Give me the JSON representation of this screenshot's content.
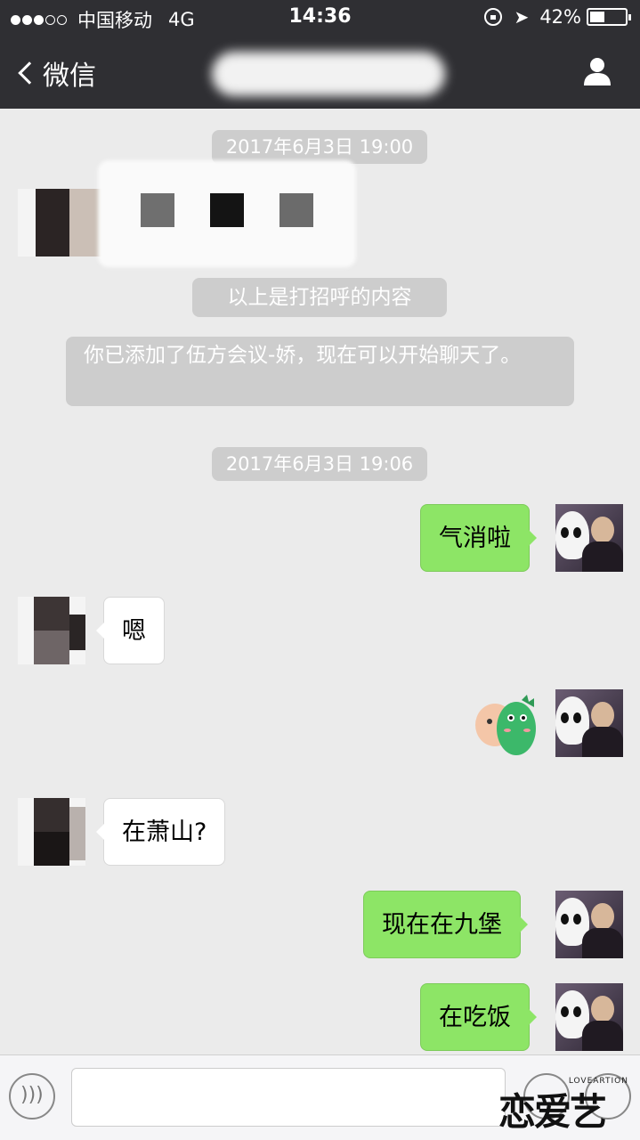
{
  "status_bar": {
    "carrier": "中国移动",
    "network": "4G",
    "time": "14:36",
    "battery": "42%",
    "battery_level": 0.42,
    "signal_dots_filled": 3,
    "signal_dots_total": 5
  },
  "nav": {
    "back_label": "微信",
    "icon": "person-icon"
  },
  "chat": {
    "timestamps": [
      "2017年6月3日 19:00",
      "2017年6月3日 19:06"
    ],
    "system_greeting": "以上是打招呼的内容",
    "system_added": "你已添加了伍方会议-娇，现在可以开始聊天了。",
    "messages": [
      {
        "side": "right",
        "text": "气消啦"
      },
      {
        "side": "left",
        "text": "嗯"
      },
      {
        "side": "right",
        "type": "sticker",
        "text": ""
      },
      {
        "side": "left",
        "text": "在萧山?"
      },
      {
        "side": "right",
        "text": "现在在九堡"
      },
      {
        "side": "right",
        "text": "在吃饭"
      }
    ]
  },
  "input_bar": {
    "watermark_main": "恋爱艺术",
    "watermark_sub": "LOVEARTION"
  },
  "colors": {
    "topbar": "#2f2f33",
    "chat_bg": "#ebebeb",
    "bubble_me": "#8de566",
    "bubble_other": "#ffffff",
    "system_pill": "#cdcdcd"
  }
}
